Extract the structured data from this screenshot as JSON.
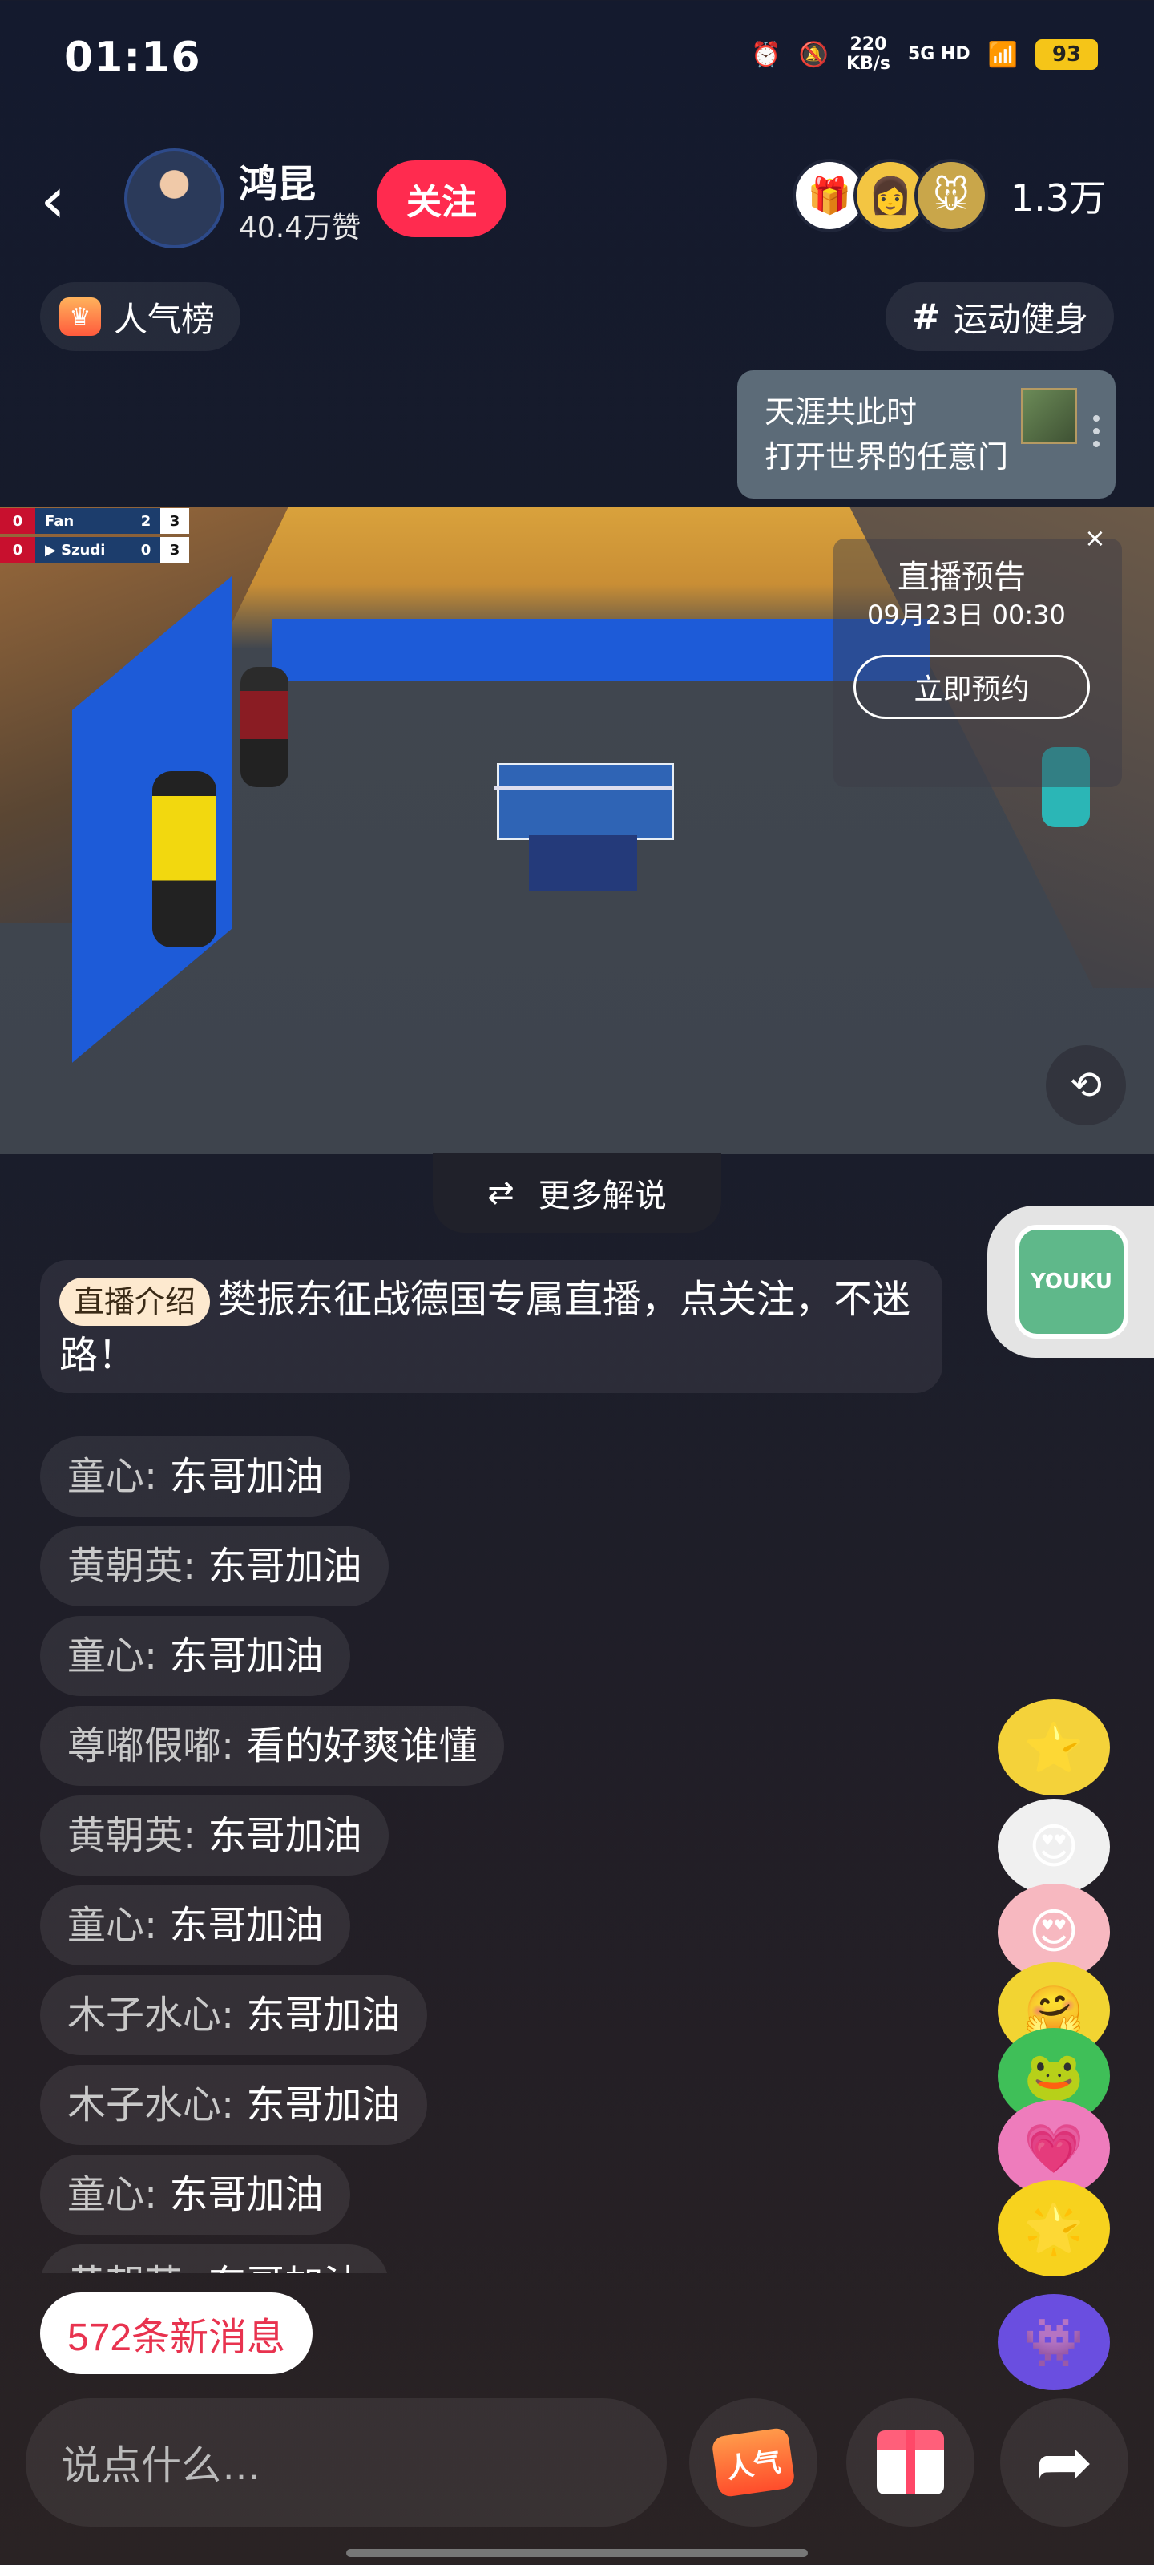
{
  "status_bar": {
    "time": "01:16",
    "net_speed_value": "220",
    "net_speed_unit": "KB/s",
    "signal": "5G HD",
    "battery": "93"
  },
  "header": {
    "host_name": "鸿昆",
    "host_likes": "40.4万赞",
    "follow_label": "关注",
    "viewer_count": "1.3万"
  },
  "tags": {
    "rank_label": "人气榜",
    "category_label": "运动健身"
  },
  "promo": {
    "line1": "天涯共此时",
    "line2": "打开世界的任意门"
  },
  "video": {
    "scoreboard": [
      {
        "set_score": "0",
        "name": "Fan",
        "points": "2",
        "games": "3"
      },
      {
        "set_score": "0",
        "name": "▶ Szudi",
        "points": "0",
        "games": "3"
      }
    ],
    "preview_title": "直播预告",
    "preview_date": "09月23日 00:30",
    "reserve_label": "立即预约",
    "close_glyph": "×"
  },
  "more_commentary_label": "更多解说",
  "youku_label": "YOUKU",
  "intro": {
    "tag": "直播介绍",
    "text": "樊振东征战德国专属直播，点关注，不迷路！"
  },
  "chat_messages": [
    {
      "user": "童心",
      "text": "东哥加油"
    },
    {
      "user": "黄朝英",
      "text": "东哥加油"
    },
    {
      "user": "童心",
      "text": "东哥加油"
    },
    {
      "user": "尊嘟假嘟",
      "text": "看的好爽谁懂"
    },
    {
      "user": "黄朝英",
      "text": "东哥加油"
    },
    {
      "user": "童心",
      "text": "东哥加油"
    },
    {
      "user": "木子水心",
      "text": "东哥加油"
    },
    {
      "user": "木子水心",
      "text": "东哥加油"
    },
    {
      "user": "童心",
      "text": "东哥加油"
    },
    {
      "user": "黄朝英",
      "text": "东哥加油"
    }
  ],
  "new_messages_label": "572条新消息",
  "bottom_bar": {
    "input_placeholder": "说点什么…",
    "popularity_label": "人气"
  },
  "colors": {
    "follow_red": "#ff2b4f",
    "new_msg_text": "#e8334f",
    "intro_tag_bg": "#fde9cf"
  }
}
